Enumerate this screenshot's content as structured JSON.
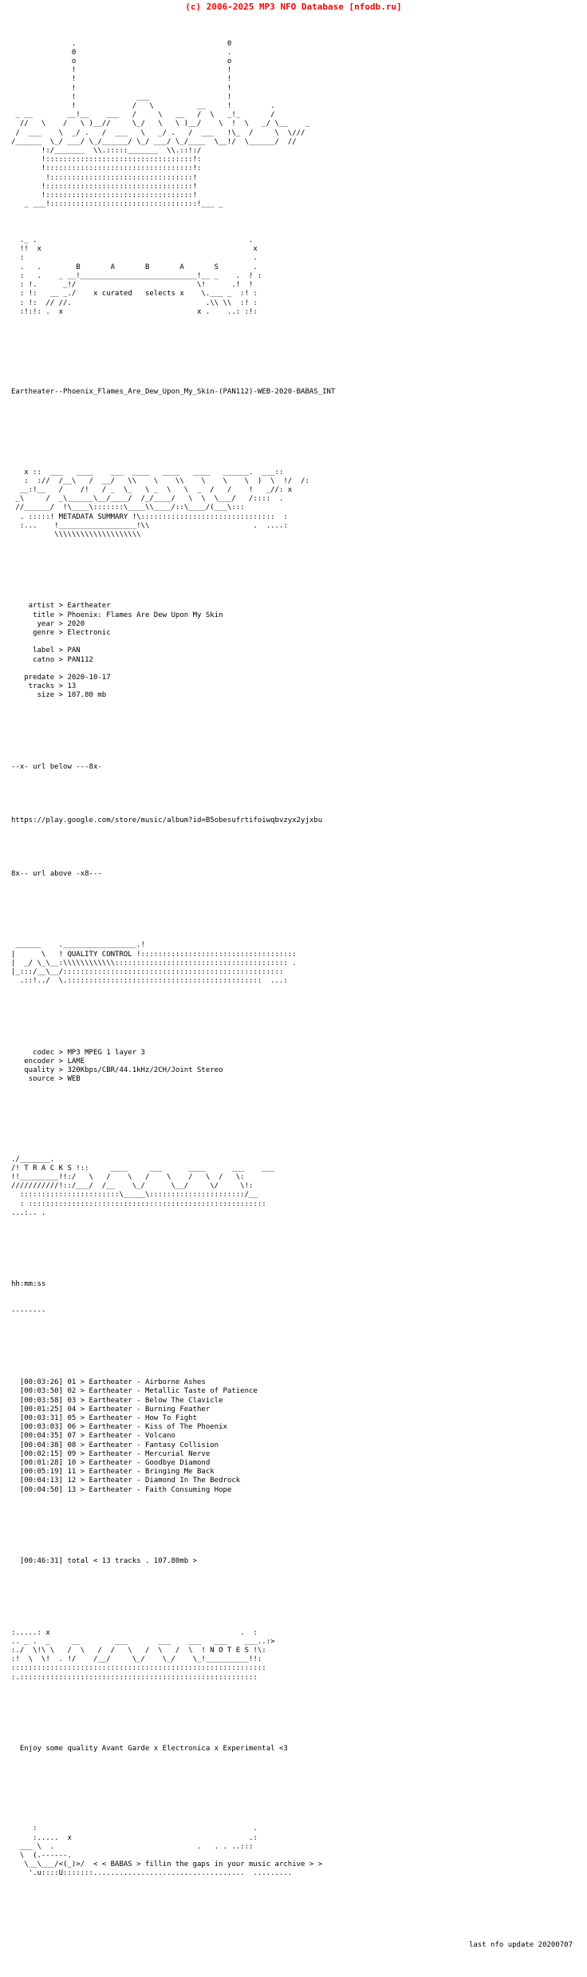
{
  "header": {
    "copyright": "(c) 2006-2025 MP3 NFO Database [nfodb.ru]"
  },
  "art": {
    "top_logo": "              .                                   0\n              0                                   .\n              o                                   o\n              !                                   !\n              !                                   !\n              !                                   !\n              !              ___                  !\n              !             /   \\          __     !         .\n _ __        __!__    ___   /     \\   __   /  \\   _!_       /\n  //   \\    /   \\ )__//     \\_/   \\   \\ )__/    \\  !  \\   _/ \\__    _\n /  ___    \\  _/ .   /  ___   \\   _/ .   /  ___   !\\_  /     \\  \\///\n/______  \\_/ ___/ \\_/______/ \\_/ ___/ \\_/____  \\__!/  \\______/  //\n       !:/_______  \\\\.:::::_______  \\\\.::!:/\n       !::::::::::::::::::::::::::::::::::!:\n       !::::::::::::::::::::::::::::::::::!:\n        !:::::::::::::::::::::::::::::::::!\n       !::::::::::::::::::::::::::::::::::!\n       !::::::::::::::::::::::::::::::::::!\n   _ ___!::::::::::::::::::::::::::::::::::!___ _",
    "babas_logo": "  ._ .                                                 .\n  !!  x                                                 x\n  :                                                     .\n  .   .        B       A       B       A       S        .\n  :   .    _ __!___________________________!__ _    .  ! :\n  : !.      _!/                            \\!      .!  !\n  : !:   __ _./    x curated   selects x    \\.___ _  :! :\n  : !:  // //.                               .\\\\ \\\\  :! :\n  :!:!: .  x                               x .    ..: :!:",
    "metadata_banner": "   x ::  ___   ____    ___  ____   ____   ____   ______.  ___::\n   :  ://  /__\\   /  __/   \\\\    \\    \\\\    \\    \\    \\  )  \\  !/  /:\n  __:!__   /    /!   / _  \\_   \\ _  \\   \\  _  /   /    !   _//: x\n _\\     /  _\\______\\__/____/  /_/____/   \\  \\  \\___/   /::::  .\n //______/  !\\____\\:::::::\\____\\\\____/::\\____/(___\\:::\n  . :::::! METADATA SUMMARY !\\:::::::::::::::::::::::::::::::  :\n  :...    !__________________!\\\\                        .  ....:\n          \\\\\\\\\\\\\\\\\\\\\\\\\\\\\\\\\\\\\\\\",
    "quality_banner": " ______    ._________________.!\n|      \\   ! QUALITY CONTROL !::::::::::::::::::::::::::::::::::::\n|  _/ \\_\\__:\\\\\\\\\\\\\\\\\\\\\\\\:::::::::::::::::::::::::::::::::::::::: .\n|_:::/__\\__/:::::::::::::::::::::::::::::::::::::::::::::::::::\n  .::!../  \\.:::::::::::::::::::::::::::::::::::::::::::::  ...:",
    "tracks_banner": "./_______.\n/! T R A C K S !::     ____     ___      ____      ___    ___\n!!_________!!:/   \\   /    \\   /    \\    /   \\  /   \\:\n///////////!::/___/  /__    \\_/      \\__/     \\/     \\!:\n  :::::::::::::::::::::::\\_____\\::::::::::::::::::::::/__\n  : :::::::::::::::::::::::::::::::::::::::::::::::::::::::\n...:.. .",
    "notes_banner": ":.....: x                                            .  :\n.. _ .  _     __        ___       ___    ___   ___    ___..:>\n:./  \\!\\ \\   /  \\   /  /   \\   /  \\   /  \\  ! N O T E S !\\:\n:!  \\  \\!  . !/    /__/     \\_/    \\_/    \\_!__________!!:\n:::::::::::::::::::::::::::::::::::::::::::::::::::::::::::\n:.:::::::::::::::::::::::::::::::::::::::::::::::::::::::",
    "footer_art": "     :                                                  .\n     :.....  x                                         .:\n  ___ \\  .                                 .   . . ..:::\n  \\  (.------.                                           \n   \\__\\___/<(_)>/  < < BABAS > fillin the gaps in your music archive > >\n    '.u::::U:::::::...................................  ........."
  },
  "release": {
    "title": "Eartheater--Phoenix_Flames_Are_Dew_Upon_My_Skin-(PAN112)-WEB-2020-BABAS_INT"
  },
  "metadata": {
    "fields": [
      {
        "label": "artist",
        "sep": ">",
        "value": "Eartheater"
      },
      {
        "label": "title",
        "sep": ">",
        "value": "Phoenix: Flames Are Dew Upon My Skin"
      },
      {
        "label": "year",
        "sep": ">",
        "value": "2020"
      },
      {
        "label": "genre",
        "sep": ">",
        "value": "Electronic"
      }
    ],
    "fields2": [
      {
        "label": "label",
        "sep": ">",
        "value": "PAN"
      },
      {
        "label": "catno",
        "sep": ">",
        "value": "PAN112"
      }
    ],
    "fields3": [
      {
        "label": "predate",
        "sep": ">",
        "value": "2020-10-17"
      },
      {
        "label": "tracks",
        "sep": ">",
        "value": "13"
      },
      {
        "label": "size",
        "sep": ">",
        "value": "107.80 mb"
      }
    ],
    "block": "    artist > Eartheater\n     title > Phoenix: Flames Are Dew Upon My Skin\n      year > 2020\n     genre > Electronic\n\n     label > PAN\n     catno > PAN112\n\n   predate > 2020-10-17\n    tracks > 13\n      size > 107.80 mb"
  },
  "url": {
    "marker_above": "--x- url below ---8x-",
    "link": "https://play.google.com/store/music/album?id=B5obesufrtifoiwqbvzyx2yjxbu",
    "marker_below": "8x-- url above -x8---"
  },
  "quality": {
    "banner_label": "QUALITY CONTROL",
    "fields": [
      {
        "label": "codec",
        "sep": ">",
        "value": "MP3 MPEG 1 layer 3"
      },
      {
        "label": "encoder",
        "sep": ">",
        "value": "LAME"
      },
      {
        "label": "quality",
        "sep": ">",
        "value": "320Kbps/CBR/44.1kHz/2CH/Joint Stereo"
      },
      {
        "label": "source",
        "sep": ">",
        "value": "WEB"
      }
    ],
    "block": "     codec > MP3 MPEG 1 layer 3\n   encoder > LAME\n   quality > 320Kbps/CBR/44.1kHz/2CH/Joint Stereo\n    source > WEB"
  },
  "tracks": {
    "banner_label": "T R A C K S",
    "time_header": "hh:mm:ss",
    "time_header_rule": "--------",
    "items": [
      {
        "time": "[00:03:26]",
        "num": "01",
        "sep": ">",
        "artist": "Eartheater",
        "dash": "-",
        "title": "Airborne Ashes"
      },
      {
        "time": "[00:03:50]",
        "num": "02",
        "sep": ">",
        "artist": "Eartheater",
        "dash": "-",
        "title": "Metallic Taste of Patience"
      },
      {
        "time": "[00:03:58]",
        "num": "03",
        "sep": ">",
        "artist": "Eartheater",
        "dash": "-",
        "title": "Below The Clavicle"
      },
      {
        "time": "[00:01:25]",
        "num": "04",
        "sep": ">",
        "artist": "Eartheater",
        "dash": "-",
        "title": "Burning Feather"
      },
      {
        "time": "[00:03:31]",
        "num": "05",
        "sep": ">",
        "artist": "Eartheater",
        "dash": "-",
        "title": "How To Fight"
      },
      {
        "time": "[00:03:03]",
        "num": "06",
        "sep": ">",
        "artist": "Eartheater",
        "dash": "-",
        "title": "Kiss of The Phoenix"
      },
      {
        "time": "[00:04:35]",
        "num": "07",
        "sep": ">",
        "artist": "Eartheater",
        "dash": "-",
        "title": "Volcano"
      },
      {
        "time": "[00:04:38]",
        "num": "08",
        "sep": ">",
        "artist": "Eartheater",
        "dash": "-",
        "title": "Fantasy Collision"
      },
      {
        "time": "[00:02:15]",
        "num": "09",
        "sep": ">",
        "artist": "Eartheater",
        "dash": "-",
        "title": "Mercurial Nerve"
      },
      {
        "time": "[00:01:28]",
        "num": "10",
        "sep": ">",
        "artist": "Eartheater",
        "dash": "-",
        "title": "Goodbye Diamond"
      },
      {
        "time": "[00:05:19]",
        "num": "11",
        "sep": ">",
        "artist": "Eartheater",
        "dash": "-",
        "title": "Bringing Me Back"
      },
      {
        "time": "[00:04:13]",
        "num": "12",
        "sep": ">",
        "artist": "Eartheater",
        "dash": "-",
        "title": "Diamond In The Bedrock"
      },
      {
        "time": "[00:04:50]",
        "num": "13",
        "sep": ">",
        "artist": "Eartheater",
        "dash": "-",
        "title": "Faith Consuming Hope"
      }
    ],
    "listing_block": "  [00:03:26] 01 > Eartheater - Airborne Ashes\n  [00:03:50] 02 > Eartheater - Metallic Taste of Patience\n  [00:03:58] 03 > Eartheater - Below The Clavicle\n  [00:01:25] 04 > Eartheater - Burning Feather\n  [00:03:31] 05 > Eartheater - How To Fight\n  [00:03:03] 06 > Eartheater - Kiss of The Phoenix\n  [00:04:35] 07 > Eartheater - Volcano\n  [00:04:38] 08 > Eartheater - Fantasy Collision\n  [00:02:15] 09 > Eartheater - Mercurial Nerve\n  [00:01:28] 10 > Eartheater - Goodbye Diamond\n  [00:05:19] 11 > Eartheater - Bringing Me Back\n  [00:04:13] 12 > Eartheater - Diamond In The Bedrock\n  [00:04:50] 13 > Eartheater - Faith Consuming Hope",
    "total_line": "  [00:46:31] total < 13 tracks . 107.80mb >",
    "total_time": "[00:46:31]",
    "total_count": "13",
    "total_size": "107.80mb"
  },
  "notes": {
    "banner_label": "N O T E S",
    "text": "  Enjoy some quality Avant Garde x Electronica x Experimental <3"
  },
  "footer": {
    "group_line": "< < BABAS > fillin the gaps in your music archive > >",
    "last_update": "last nfo update 20200707"
  },
  "colors": {
    "header_red": "#ff0000",
    "text_black": "#000000",
    "background": "#ffffff"
  }
}
